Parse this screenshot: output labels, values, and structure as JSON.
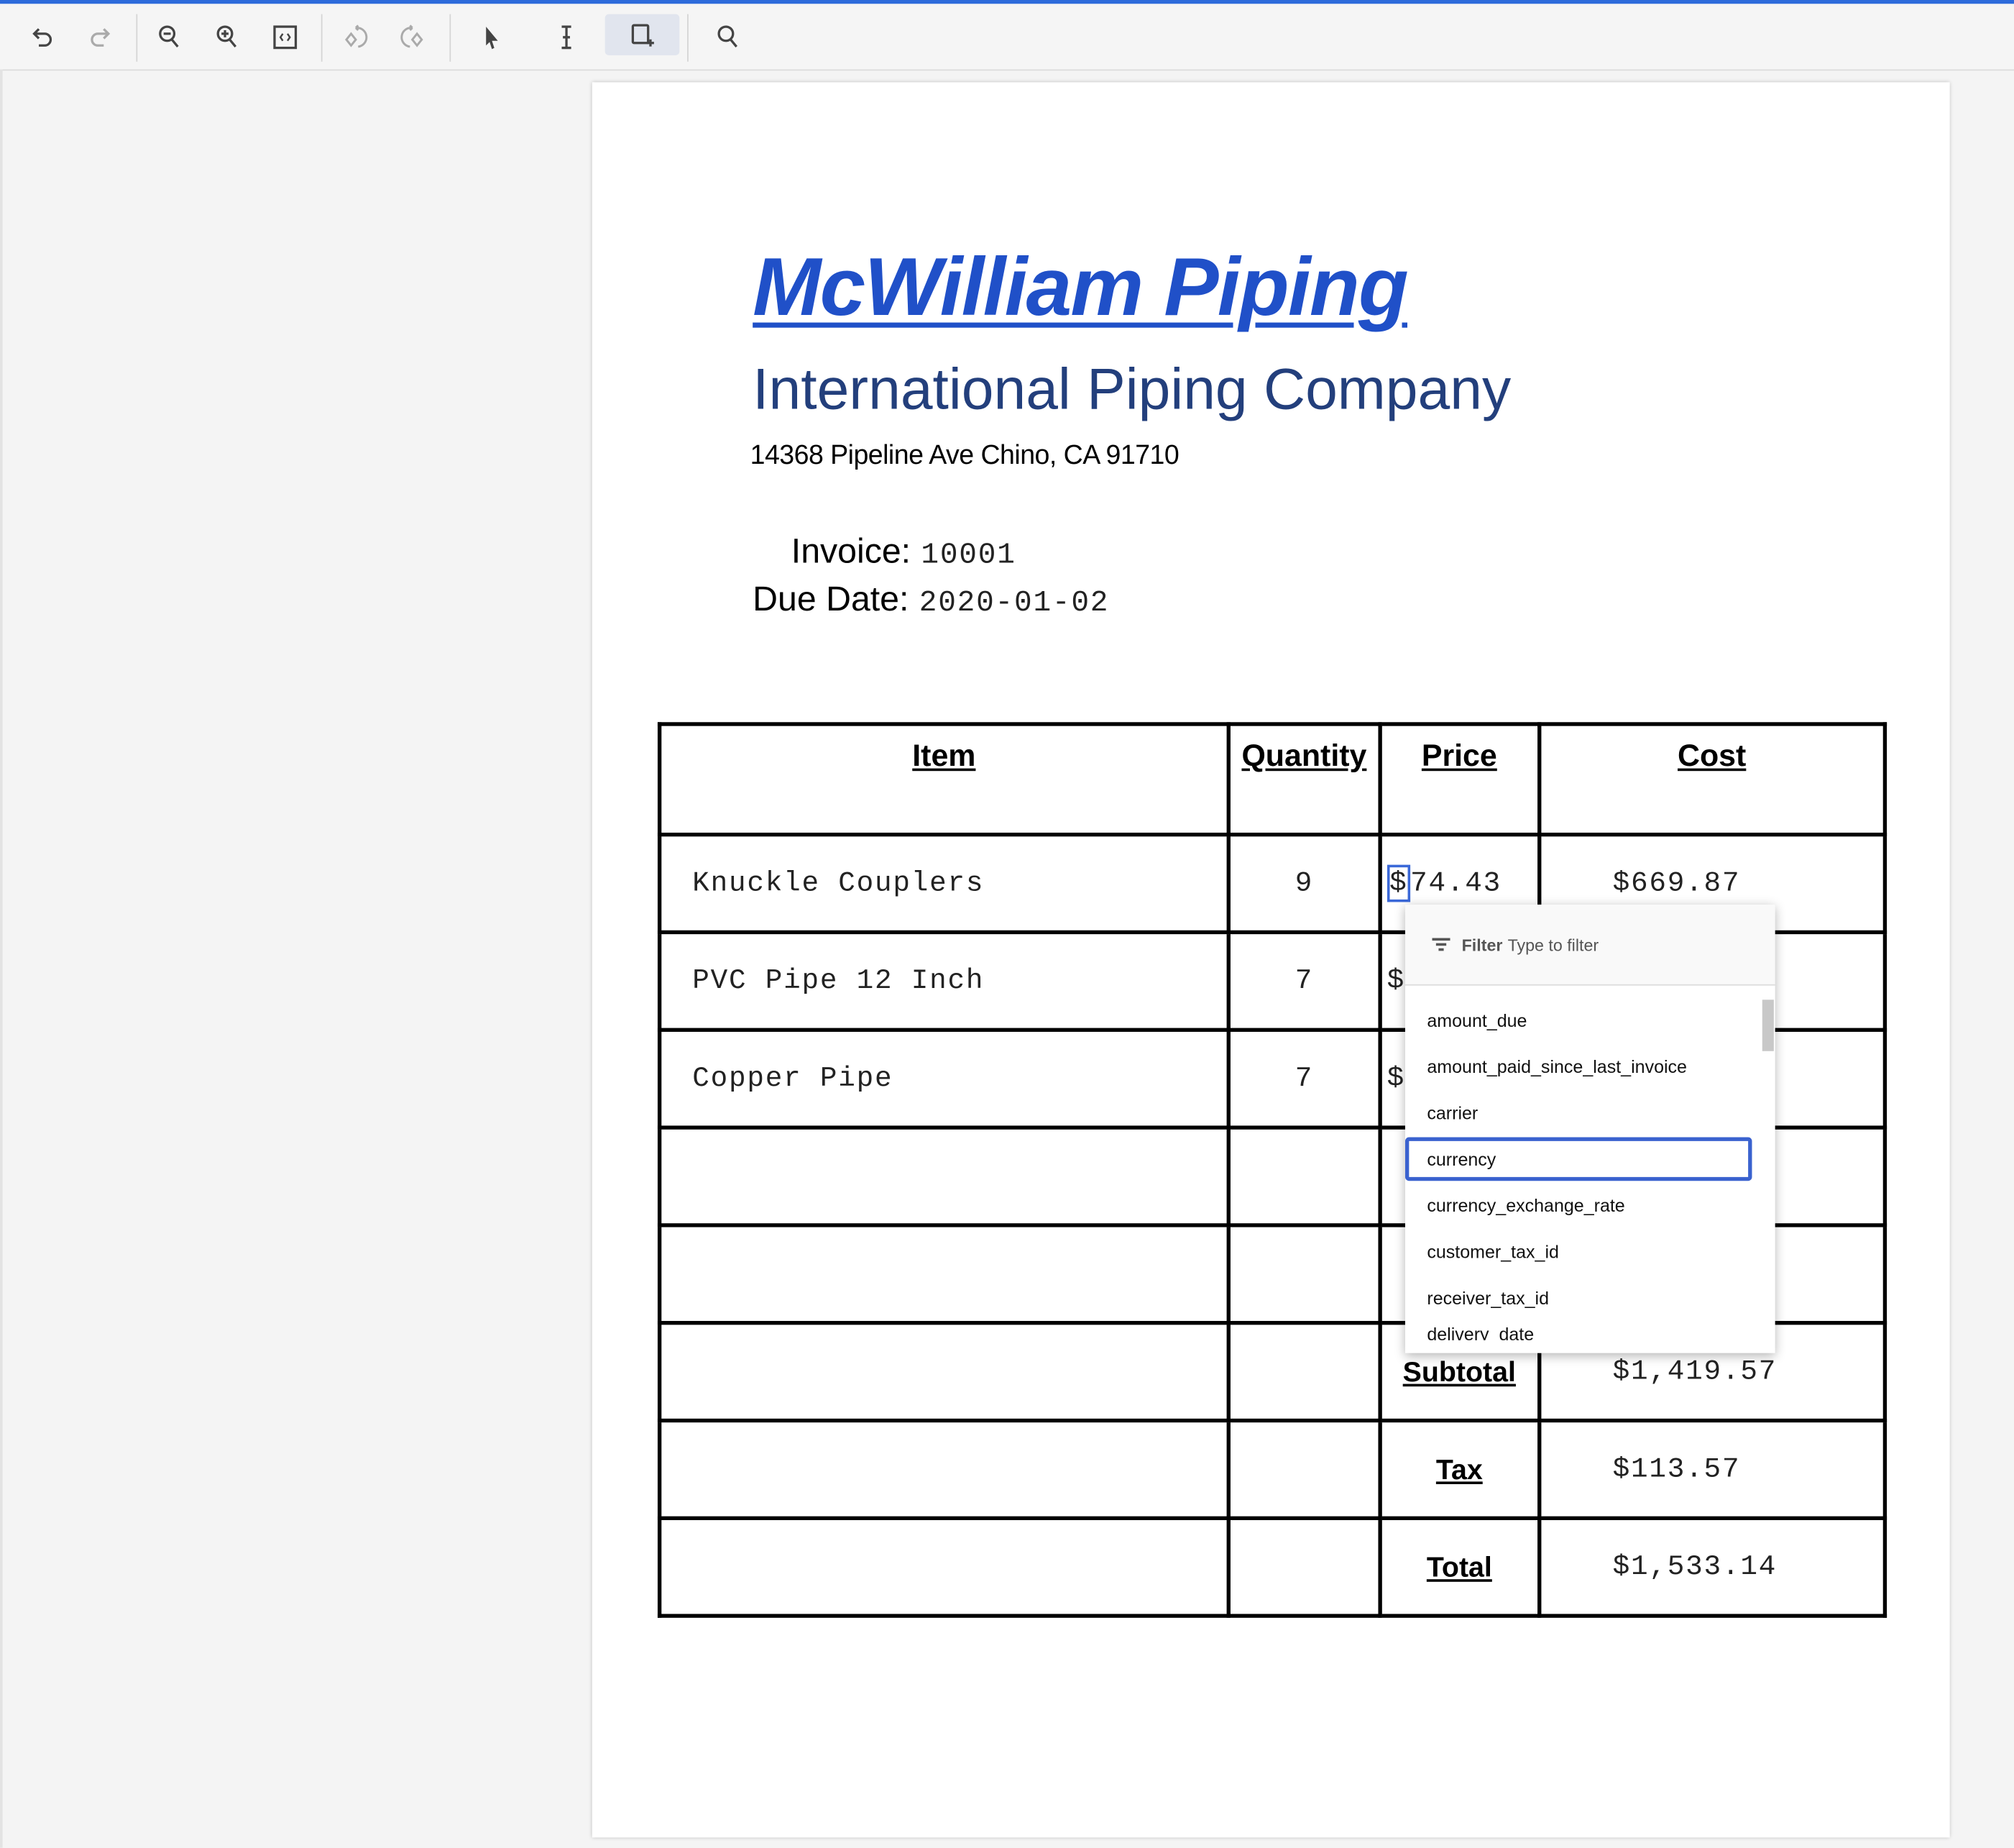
{
  "toolbar": {
    "accent": "#2d6bdb",
    "buttons": [
      "undo-icon",
      "redo-icon",
      "zoom-out-icon",
      "zoom-in-icon",
      "fit-page-icon",
      "rotate-left-icon",
      "rotate-right-icon",
      "pointer-icon",
      "text-select-icon",
      "draw-box-icon",
      "search-icon"
    ],
    "active": "draw-box-icon"
  },
  "document": {
    "title": "McWilliam Piping",
    "subtitle": "International Piping Company",
    "address": "14368 Pipeline Ave Chino, CA 91710",
    "invoice_label": "Invoice:",
    "invoice_value": "10001",
    "due_label": "Due Date:",
    "due_value": "2020-01-02",
    "title_color": "#2050c8",
    "subtitle_color": "#233f7c"
  },
  "table": {
    "headers": [
      "Item",
      "Quantity",
      "Price",
      "Cost"
    ],
    "rows": [
      {
        "item": "Knuckle Couplers",
        "qty": "9",
        "price_prefix": "$",
        "price_rest": "74.43",
        "cost": "$669.87"
      },
      {
        "item": "PVC Pipe 12 Inch",
        "qty": "7",
        "price": "$",
        "cost": ""
      },
      {
        "item": "Copper Pipe",
        "qty": "7",
        "price": "$",
        "cost": ""
      }
    ],
    "subtotal_label": "Subtotal",
    "subtotal": "$1,419.57",
    "tax_label": "Tax",
    "tax": "$113.57",
    "total_label": "Total",
    "total": "$1,533.14"
  },
  "dropdown": {
    "filter_label": "Filter",
    "filter_placeholder": "Type to filter",
    "items": [
      "amount_due",
      "amount_paid_since_last_invoice",
      "carrier",
      "currency",
      "currency_exchange_rate",
      "customer_tax_id",
      "receiver_tax_id",
      "delivery_date"
    ],
    "selected": "currency",
    "selected_color": "#3a62cf"
  }
}
